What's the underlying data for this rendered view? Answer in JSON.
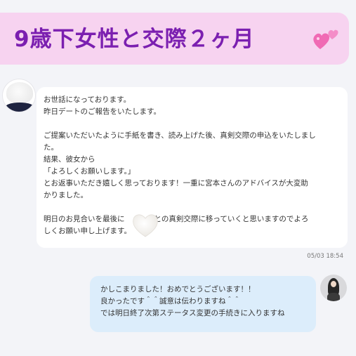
{
  "title": "9歳下女性と交際２ヶ月",
  "icons": {
    "title_decoration": "two-pink-hearts-icon",
    "left_avatar": "white-heart-avatar",
    "right_avatar": "user-photo-avatar",
    "overlay": "white-heart-icon"
  },
  "colors": {
    "title_text": "#7b1fb0",
    "title_background": "#f7d3f0",
    "received_bubble": "#ffffff",
    "sent_bubble": "#dcedfb"
  },
  "messages": [
    {
      "side": "left",
      "lines": [
        "お世話になっております。",
        "昨日デートのご報告をいたします。",
        "",
        "ご提案いただいたように手紙を書き、読み上げた後、真剣交際の申込をいたしまし",
        "た。",
        "結果、彼女から",
        "「よろしくお願いします。」",
        "とお返事いただき嬉しく思っております！一重に宮本さんのアドバイスが大変助",
        "かりました。",
        "",
        "明日のお見合いを最後に　　　んとの真剣交際に移っていくと思いますのでよろ",
        "しくお願い申し上げます。"
      ],
      "timestamp": "05/03 18:54"
    },
    {
      "side": "right",
      "lines": [
        "かしこまりました！おめでとうございます！！",
        "良かったです＾＾誠意は伝わりますね＾＾",
        "では明日終了次第ステータス変更の手続きに入りますね"
      ]
    }
  ]
}
